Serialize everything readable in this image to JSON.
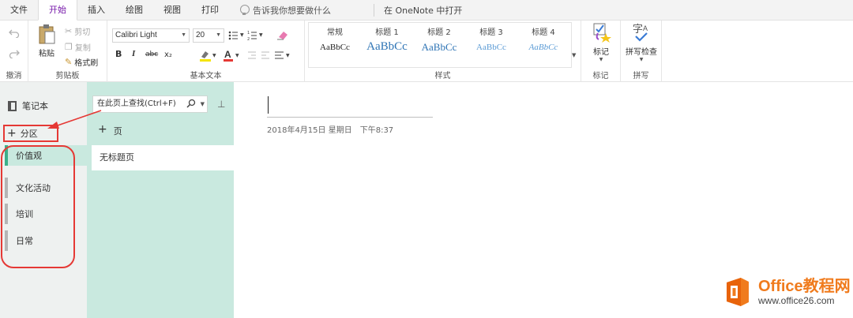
{
  "menubar": {
    "tabs": [
      "文件",
      "开始",
      "插入",
      "绘图",
      "视图",
      "打印"
    ],
    "tell_me": "告诉我你想要做什么",
    "open_in": "在 OneNote 中打开"
  },
  "ribbon": {
    "undo_group": "撤消",
    "clipboard": {
      "label": "剪贴板",
      "paste": "粘贴",
      "cut": "剪切",
      "copy": "复制",
      "format_painter": "格式刷"
    },
    "basic_text": {
      "label": "基本文本",
      "font": "Calibri Light",
      "size": "20",
      "bold": "B",
      "italic": "I",
      "strike": "abc",
      "sub": "x₂"
    },
    "styles": {
      "label": "样式",
      "items": [
        {
          "name": "常规",
          "preview": "AaBbCc"
        },
        {
          "name": "标题 1",
          "preview": "AaBbCc"
        },
        {
          "name": "标题 2",
          "preview": "AaBbCc"
        },
        {
          "name": "标题 3",
          "preview": "AaBbCc"
        },
        {
          "name": "标题 4",
          "preview": "AaBbCc"
        }
      ]
    },
    "tags": {
      "label": "标记",
      "button": "标记"
    },
    "spelling": {
      "label": "拼写",
      "button": "拼写检查"
    }
  },
  "notebook": {
    "title": "笔记本",
    "add_section": "分区",
    "sections": [
      {
        "label": "价值观",
        "active": true
      },
      {
        "label": "文化活动",
        "active": false
      },
      {
        "label": "培训",
        "active": false
      },
      {
        "label": "日常",
        "active": false
      }
    ]
  },
  "pages": {
    "search_placeholder": "在此页上查找(Ctrl+F)",
    "add_page": "页",
    "items": [
      "无标题页"
    ]
  },
  "note": {
    "date": "2018年4月15日 星期日",
    "time": "下午8:37"
  },
  "watermark": {
    "line1": "Office教程网",
    "line2": "www.office26.com"
  },
  "colors": {
    "accent": "#7719aa",
    "section_active": "#3cb08a",
    "page_pane": "#c9e9df",
    "annotation": "#e53935",
    "watermark_orange": "#f07b1d"
  }
}
